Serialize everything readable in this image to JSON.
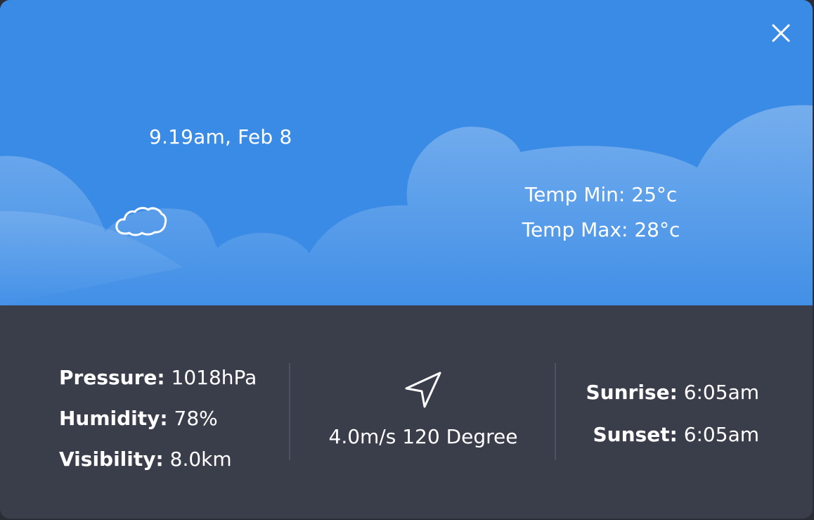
{
  "header": {
    "datetime": "9.19am, Feb 8",
    "condition_icon": "cloud-icon",
    "temp_min": "Temp Min: 25°c",
    "temp_max": "Temp Max: 28°c",
    "close_icon": "close-icon"
  },
  "stats": {
    "pressure_label": "Pressure:",
    "pressure_value": "1018hPa",
    "humidity_label": "Humidity:",
    "humidity_value": "78%",
    "visibility_label": "Visibility:",
    "visibility_value": "8.0km"
  },
  "wind": {
    "icon": "navigation-arrow-icon",
    "text": "4.0m/s 120 Degree"
  },
  "sun": {
    "sunrise_label": "Sunrise:",
    "sunrise_value": "6:05am",
    "sunset_label": "Sunset:",
    "sunset_value": "6:05am"
  },
  "colors": {
    "sky": "#3a8be6",
    "panel": "#3a3d4a",
    "text": "#ffffff"
  }
}
